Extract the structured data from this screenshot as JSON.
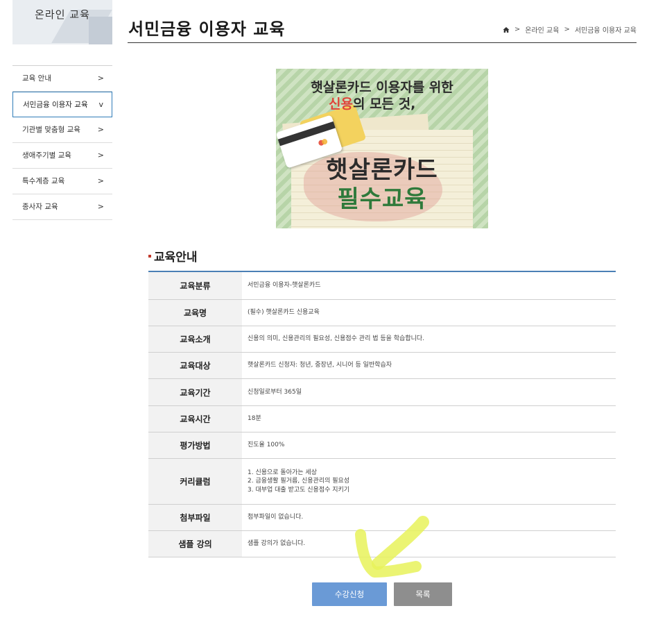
{
  "sidebar": {
    "title": "온라인 교육",
    "items": [
      {
        "label": "교육 안내",
        "arrow": ">"
      },
      {
        "label": "서민금융 이용자 교육",
        "arrow": "v"
      },
      {
        "label": "기관별 맞춤형 교육",
        "arrow": ">"
      },
      {
        "label": "생애주기별 교육",
        "arrow": ">"
      },
      {
        "label": "특수계층 교육",
        "arrow": ">"
      },
      {
        "label": "종사자 교육",
        "arrow": ">"
      }
    ]
  },
  "header": {
    "title": "서민금융 이용자 교육",
    "breadcrumb": [
      ">",
      "온라인 교육",
      ">",
      "서민금융 이용자 교육"
    ]
  },
  "banner": {
    "line1": "햇살론카드 이용자를 위한",
    "line2_red": "신용",
    "line2_rest": "의 모든 것,",
    "big1": "햇살론카드",
    "big2": "필수교육"
  },
  "section": {
    "title": "교육안내"
  },
  "info": [
    {
      "label": "교육분류",
      "value": [
        "서민금융 이용자-햇살론카드"
      ]
    },
    {
      "label": "교육명",
      "value": [
        "(필수) 햇살론카드 신용교육"
      ]
    },
    {
      "label": "교육소개",
      "value": [
        "신용의 의미, 신용관리의 필요성, 신용점수 관리 법 등을 학습합니다."
      ]
    },
    {
      "label": "교육대상",
      "value": [
        "햇살론카드 신청자: 청년, 중장년, 시니어 등 일반학습자"
      ]
    },
    {
      "label": "교육기간",
      "value": [
        "신청일로부터 365일"
      ]
    },
    {
      "label": "교육시간",
      "value": [
        "18분"
      ]
    },
    {
      "label": "평가방법",
      "value": [
        "진도율 100%"
      ]
    },
    {
      "label": "커리큘럼",
      "value": [
        "1. 신용으로 돌아가는 세상",
        "2. 금융생활 필거름, 신용관리의 필요성",
        "3. 대부업 대출 받고도 신용점수 지키기"
      ]
    },
    {
      "label": "첨부파일",
      "value": [
        "첨부파일이 없습니다."
      ]
    },
    {
      "label": "샘플 강의",
      "value": [
        "샘플 강의가 없습니다."
      ]
    }
  ],
  "buttons": {
    "apply": "수강신청",
    "list": "목록"
  },
  "colors": {
    "accent_blue": "#6a9ad6",
    "table_top": "#4a7fb5",
    "highlight": "#e8f25a",
    "banner_green": "#2f7a3b",
    "banner_red": "#e0443a"
  }
}
